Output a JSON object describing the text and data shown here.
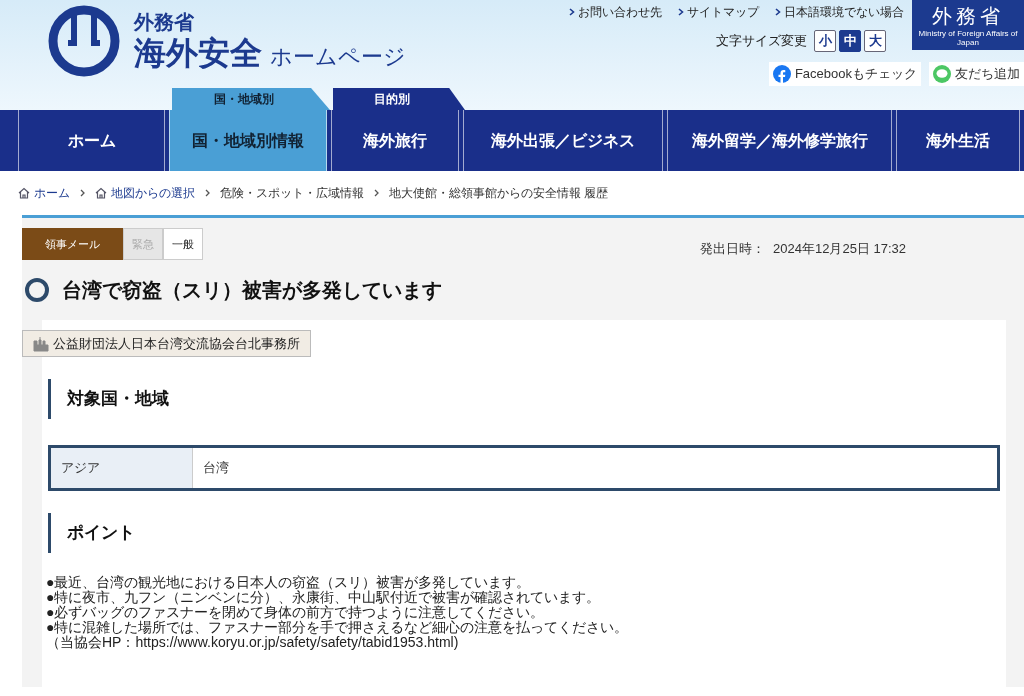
{
  "header": {
    "site_small": "外務省",
    "site_big": "海外安全",
    "site_suffix": "ホームページ",
    "top_links": [
      "お問い合わせ先",
      "サイトマップ",
      "日本語環境でない場合"
    ],
    "ministry_logo": {
      "name": "外務省",
      "sub": "Ministry of Foreign Affairs of Japan"
    },
    "font_size": {
      "label": "文字サイズ変更",
      "options": [
        {
          "label": "小",
          "selected": false
        },
        {
          "label": "中",
          "selected": true
        },
        {
          "label": "大",
          "selected": false
        }
      ]
    },
    "social": [
      {
        "kind": "facebook",
        "label": "Facebookもチェック"
      },
      {
        "kind": "line",
        "label": "友だち追加"
      }
    ]
  },
  "nav_groups": [
    {
      "label": "国・地域別",
      "selected": true
    },
    {
      "label": "目的別",
      "selected": false
    }
  ],
  "nav": [
    {
      "label": "ホーム",
      "selected": false
    },
    {
      "label": "国・地域別情報",
      "selected": true
    },
    {
      "label": "海外旅行",
      "selected": false
    },
    {
      "label": "海外出張／ビジネス",
      "selected": false
    },
    {
      "label": "海外留学／海外修学旅行",
      "selected": false
    },
    {
      "label": "海外生活",
      "selected": false
    }
  ],
  "breadcrumb": [
    {
      "label": "ホーム",
      "kind": "home"
    },
    {
      "label": "地図からの選択",
      "kind": "home"
    },
    {
      "label": "危険・スポット・広域情報",
      "kind": "plain"
    },
    {
      "label": "地大使館・総領事館からの安全情報 履歴",
      "kind": "plain"
    }
  ],
  "article": {
    "category": "領事メール",
    "levels": [
      {
        "label": "緊急",
        "selected": false
      },
      {
        "label": "一般",
        "selected": true
      }
    ],
    "date_label": "発出日時：",
    "date": "2024年12月25日 17:32",
    "title": "台湾で窃盗（スリ）被害が多発しています",
    "source": "公益財団法人日本台湾交流協会台北事務所",
    "sections": [
      {
        "kind": "table",
        "heading": "対象国・地域",
        "rows": [
          {
            "region": "アジア",
            "country": "台湾"
          }
        ]
      },
      {
        "kind": "text",
        "heading": "ポイント",
        "lines": [
          "●最近、台湾の観光地における日本人の窃盗（スリ）被害が多発しています。",
          "●特に夜市、九フン（ニンベンに分）、永康街、中山駅付近で被害が確認されています。",
          "●必ずバッグのファスナーを閉めて身体の前方で持つように注意してください。",
          "●特に混雑した場所では、ファスナー部分を手で押さえるなど細心の注意を払ってください。",
          "（当協会HP：https://www.koryu.or.jp/safety/safety/tabid1953.html)"
        ]
      }
    ]
  }
}
